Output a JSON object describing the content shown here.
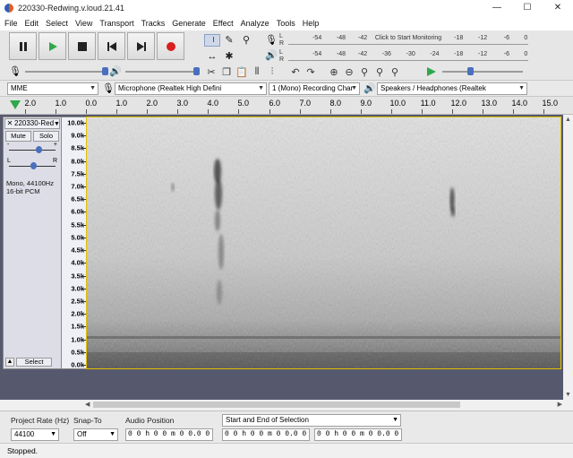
{
  "window": {
    "title": "220330-Redwing.v.loud.21.41",
    "minimize": "—",
    "maximize": "☐",
    "close": "✕"
  },
  "menu": [
    "File",
    "Edit",
    "Select",
    "View",
    "Transport",
    "Tracks",
    "Generate",
    "Effect",
    "Analyze",
    "Tools",
    "Help"
  ],
  "meters": {
    "record_ticks": [
      "-54",
      "-48",
      "-42",
      "Click to Start Monitoring",
      "-18",
      "-12",
      "-6",
      "0"
    ],
    "playback_ticks": [
      "-54",
      "-48",
      "-42",
      "-36",
      "-30",
      "-24",
      "-18",
      "-12",
      "-6",
      "0"
    ],
    "left_label": "L",
    "right_label": "R"
  },
  "devices": {
    "host": "MME",
    "recording_device": "Microphone (Realtek High Defini",
    "channels": "1 (Mono) Recording Char",
    "playback_device": "Speakers / Headphones (Realtek"
  },
  "timeline": {
    "labels": [
      "2.0",
      "1.0",
      "0.0",
      "1.0",
      "2.0",
      "3.0",
      "4.0",
      "5.0",
      "6.0",
      "7.0",
      "8.0",
      "9.0",
      "10.0",
      "11.0",
      "12.0",
      "13.0",
      "14.0",
      "15.0"
    ]
  },
  "track": {
    "name": "220330-Red",
    "mute": "Mute",
    "solo": "Solo",
    "gain_minus": "-",
    "gain_plus": "+",
    "pan_left": "L",
    "pan_right": "R",
    "info_line1": "Mono, 44100Hz",
    "info_line2": "16-bit PCM",
    "select": "Select",
    "freq_labels": [
      "10.0k",
      "9.0k",
      "8.5k",
      "8.0k",
      "7.5k",
      "7.0k",
      "6.5k",
      "6.0k",
      "5.5k",
      "5.0k",
      "4.5k",
      "4.0k",
      "3.5k",
      "3.0k",
      "2.5k",
      "2.0k",
      "1.5k",
      "1.0k",
      "0.5k",
      "0.0k"
    ]
  },
  "selection_toolbar": {
    "project_rate_label": "Project Rate (Hz)",
    "project_rate": "44100",
    "snap_to_label": "Snap-To",
    "snap_to": "Off",
    "audio_position_label": "Audio Position",
    "audio_position": "0 0 h 0 0 m 0 0.0 0 0 s",
    "selection_mode": "Start and End of Selection",
    "selection_start": "0 0 h 0 0 m 0 0.0 0 0 s",
    "selection_end": "0 0 h 0 0 m 0 0.0 0 0 s"
  },
  "status": "Stopped.",
  "colors": {
    "play": "#2ea84a",
    "record": "#d92020",
    "track_bg": "#56596e",
    "selection_border": "#e0c000"
  }
}
